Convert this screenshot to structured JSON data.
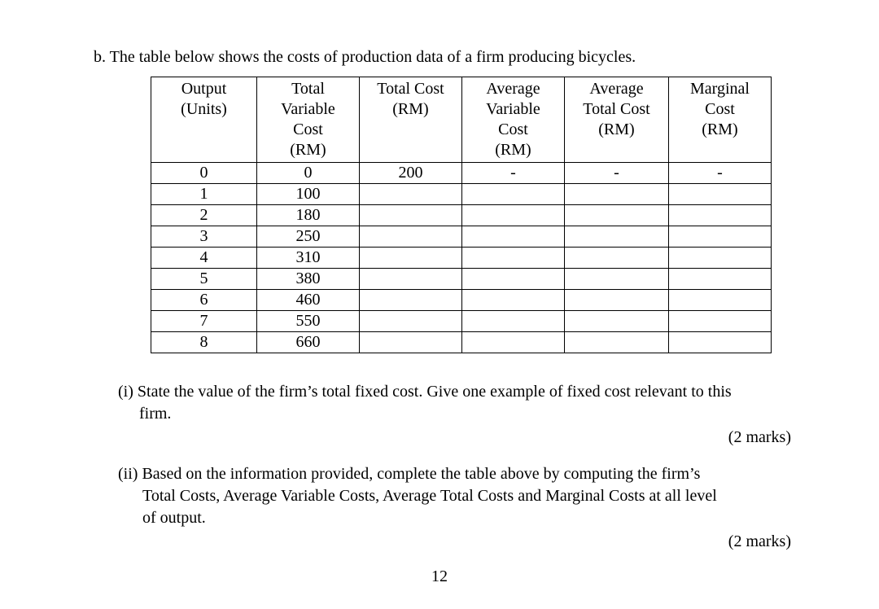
{
  "intro": {
    "label": "b.",
    "text": "The table below shows the costs of production data of a firm producing bicycles."
  },
  "table": {
    "headers": {
      "output": "Output (Units)",
      "tvc": "Total Variable Cost (RM)",
      "tc": "Total Cost (RM)",
      "avc": "Average Variable Cost (RM)",
      "atc": "Average Total Cost (RM)",
      "mc": "Marginal Cost (RM)"
    },
    "rows": [
      {
        "output": "0",
        "tvc": "0",
        "tc": "200",
        "avc": "-",
        "atc": "-",
        "mc": "-"
      },
      {
        "output": "1",
        "tvc": "100",
        "tc": "",
        "avc": "",
        "atc": "",
        "mc": ""
      },
      {
        "output": "2",
        "tvc": "180",
        "tc": "",
        "avc": "",
        "atc": "",
        "mc": ""
      },
      {
        "output": "3",
        "tvc": "250",
        "tc": "",
        "avc": "",
        "atc": "",
        "mc": ""
      },
      {
        "output": "4",
        "tvc": "310",
        "tc": "",
        "avc": "",
        "atc": "",
        "mc": ""
      },
      {
        "output": "5",
        "tvc": "380",
        "tc": "",
        "avc": "",
        "atc": "",
        "mc": ""
      },
      {
        "output": "6",
        "tvc": "460",
        "tc": "",
        "avc": "",
        "atc": "",
        "mc": ""
      },
      {
        "output": "7",
        "tvc": "550",
        "tc": "",
        "avc": "",
        "atc": "",
        "mc": ""
      },
      {
        "output": "8",
        "tvc": "660",
        "tc": "",
        "avc": "",
        "atc": "",
        "mc": ""
      }
    ]
  },
  "questions": {
    "i": {
      "num": "(i)",
      "line1": "State the value of the firm’s total fixed cost. Give one example of fixed cost relevant to this",
      "line2": "firm.",
      "marks": "(2 marks)"
    },
    "ii": {
      "num": "(ii)",
      "line1": "Based on the information provided, complete the table above by computing the firm’s",
      "line2": "Total Costs, Average Variable Costs, Average Total Costs and Marginal Costs at all level",
      "line3": "of output.",
      "marks": "(2 marks)"
    }
  },
  "page_number": "12"
}
